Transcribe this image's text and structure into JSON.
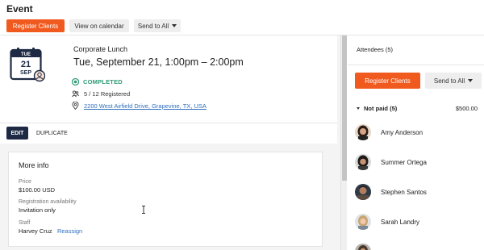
{
  "header": {
    "title": "Event",
    "register_label": "Register Clients",
    "calendar_label": "View on calendar",
    "send_label": "Send to All"
  },
  "event": {
    "cal_day": "TUE",
    "cal_date": "21",
    "cal_month": "SEP",
    "title": "Corporate Lunch",
    "datetime": "Tue, September 21, 1:00pm – 2:00pm",
    "status": "COMPLETED",
    "registered": "5 / 12 Registered",
    "address": "2200 West Airfield Drive, Grapevine, TX, USA"
  },
  "tabs": {
    "edit": "EDIT",
    "duplicate": "DUPLICATE"
  },
  "more_info": {
    "title": "More info",
    "price_label": "Price",
    "price": "$100.00 USD",
    "availability_label": "Registration availability",
    "availability": "Invitation only",
    "staff_label": "Staff",
    "staff": "Harvey Cruz",
    "reassign": "Reassign"
  },
  "attendees": {
    "title": "Attendees (5)",
    "register_label": "Register Clients",
    "send_label": "Send to All",
    "group_label": "Not paid (5)",
    "group_amount": "$500.00",
    "people": [
      {
        "name": "Amy Anderson"
      },
      {
        "name": "Summer Ortega"
      },
      {
        "name": "Stephen Santos"
      },
      {
        "name": "Sarah Landry"
      }
    ]
  },
  "colors": {
    "accent": "#f15a1f",
    "status": "#2d9a77",
    "link": "#2f6fbd",
    "tab_active": "#1e2a44"
  }
}
